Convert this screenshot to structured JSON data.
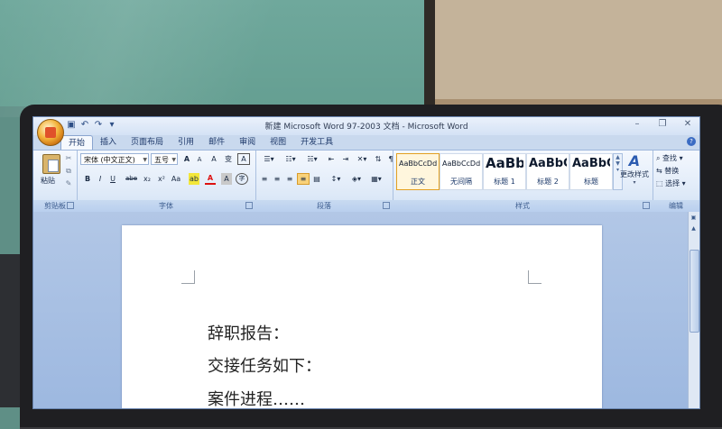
{
  "window": {
    "title": "新建 Microsoft Word 97-2003 文档 - Microsoft Word"
  },
  "quick_access": [
    "save-icon",
    "undo-icon",
    "redo-icon",
    "customize-icon"
  ],
  "window_controls": [
    "minimize",
    "restore",
    "close"
  ],
  "tabs": [
    {
      "label": "开始",
      "active": true
    },
    {
      "label": "插入"
    },
    {
      "label": "页面布局"
    },
    {
      "label": "引用"
    },
    {
      "label": "邮件"
    },
    {
      "label": "审阅"
    },
    {
      "label": "视图"
    },
    {
      "label": "开发工具"
    }
  ],
  "ribbon": {
    "clipboard": {
      "group_label": "剪贴板",
      "paste_label": "粘贴"
    },
    "font": {
      "group_label": "字体",
      "font_name": "宋体 (中文正文)",
      "font_size": "五号",
      "grow": "A",
      "shrink": "A",
      "clear": "A",
      "phonetic": "变",
      "border_char": "A",
      "bold": "B",
      "italic": "I",
      "underline": "U",
      "strike": "abe",
      "subscript": "x₂",
      "superscript": "x²",
      "case": "Aa",
      "highlight": "ab",
      "font_color": "A",
      "shading": "A",
      "enclose": "字"
    },
    "paragraph": {
      "group_label": "段落"
    },
    "styles": {
      "group_label": "样式",
      "items": [
        {
          "preview": "AaBbCcDd",
          "name": "正文",
          "selected": true
        },
        {
          "preview": "AaBbCcDd",
          "name": "无间隔"
        },
        {
          "preview": "AaBb",
          "name": "标题 1"
        },
        {
          "preview": "AaBbC",
          "name": "标题 2"
        },
        {
          "preview": "AaBbC",
          "name": "标题"
        }
      ],
      "change_styles_label": "更改样式"
    },
    "editing": {
      "group_label": "编辑",
      "find": "查找",
      "replace": "替换",
      "select": "选择"
    }
  },
  "document": {
    "lines": [
      "辞职报告：",
      "交接任务如下：",
      "案件进程……"
    ]
  }
}
